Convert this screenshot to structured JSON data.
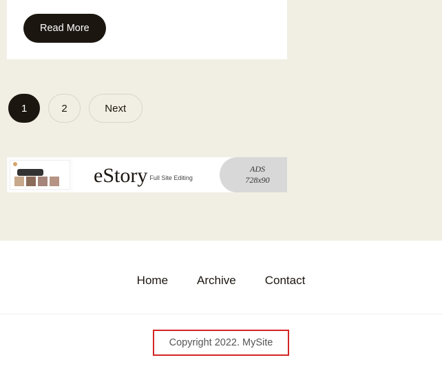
{
  "card": {
    "read_more": "Read More"
  },
  "pagination": {
    "page1": "1",
    "page2": "2",
    "next": "Next"
  },
  "ad": {
    "title": "eStory",
    "subtitle": "Full Site Editing",
    "ads_label": "ADS",
    "ads_size": "728x90"
  },
  "footer": {
    "home": "Home",
    "archive": "Archive",
    "contact": "Contact",
    "copyright": "Copyright 2022. MySite"
  }
}
